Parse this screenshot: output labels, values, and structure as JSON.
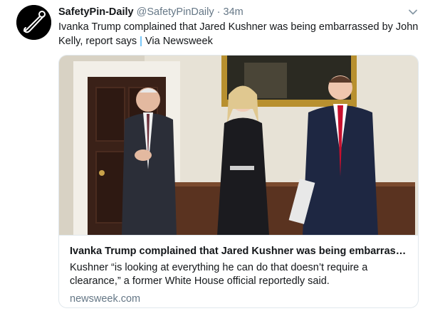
{
  "tweet": {
    "display_name": "SafetyPin-Daily",
    "handle": "@SafetyPinDaily",
    "separator": "·",
    "time": "34m",
    "text_main": "Ivanka Trump complained that Jared Kushner was being embarrassed by John Kelly, report says",
    "text_pipe": "|",
    "text_via": "Via Newsweek",
    "avatar_icon": "safety-pin-logo",
    "caret_icon": "chevron-down-icon"
  },
  "card": {
    "title": "Ivanka Trump complained that Jared Kushner was being embarrasse...",
    "description": "Kushner “is looking at everything he can do that doesn’t require a clearance,” a former White House official reportedly said.",
    "domain": "newsweek.com",
    "image_icon": "article-photo"
  },
  "colors": {
    "link_blue": "#1da1f2",
    "meta_gray": "#657786",
    "border": "#e1e8ed"
  }
}
